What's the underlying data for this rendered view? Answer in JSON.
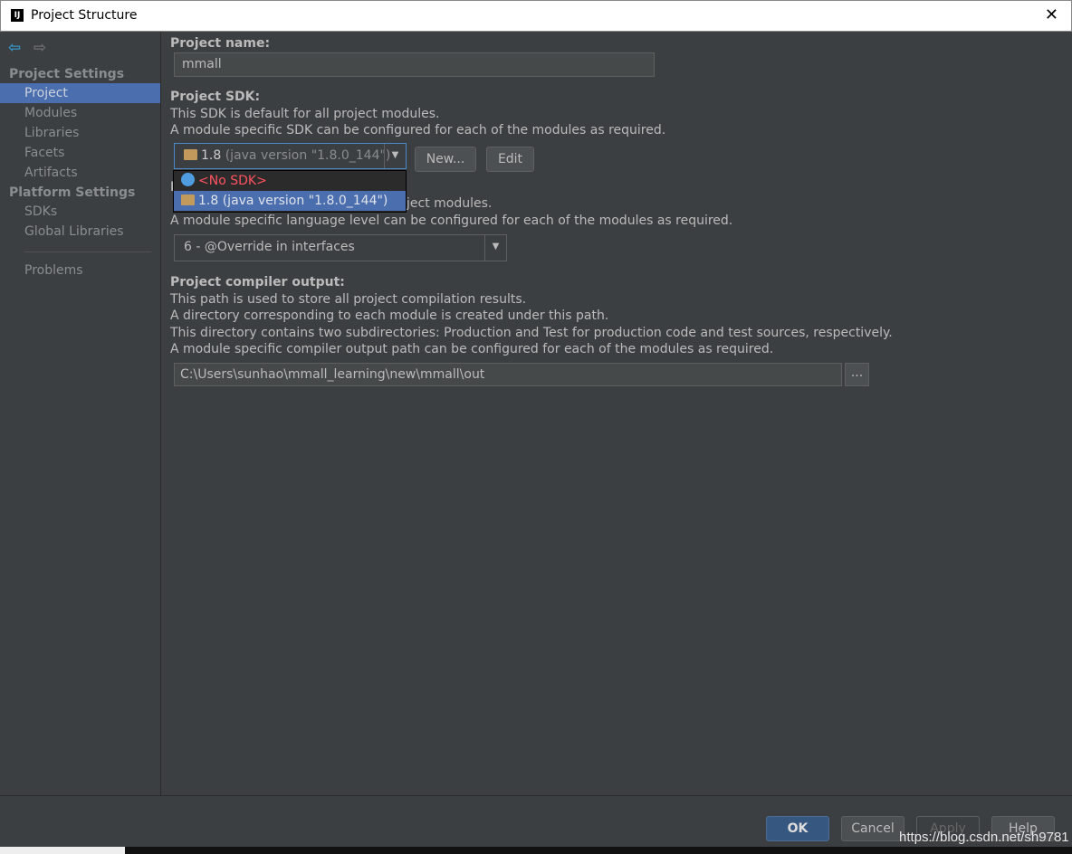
{
  "window": {
    "title": "Project Structure",
    "close_icon": "close-icon"
  },
  "sidebar": {
    "back_icon": "arrow-left-icon",
    "forward_icon": "arrow-right-icon",
    "section1": "Project Settings",
    "items1": [
      {
        "label": "Project",
        "selected": true
      },
      {
        "label": "Modules"
      },
      {
        "label": "Libraries"
      },
      {
        "label": "Facets"
      },
      {
        "label": "Artifacts"
      }
    ],
    "section2": "Platform Settings",
    "items2": [
      {
        "label": "SDKs"
      },
      {
        "label": "Global Libraries"
      }
    ],
    "problems": "Problems"
  },
  "main": {
    "name_label": "Project name:",
    "name_value": "mmall",
    "sdk_label": "Project SDK:",
    "sdk_desc1": "This SDK is default for all project modules.",
    "sdk_desc2": "A module specific SDK can be configured for each of the modules as required.",
    "sdk_selected_version": "1.8",
    "sdk_selected_detail": "(java version \"1.8.0_144\")",
    "new_button": "New...",
    "edit_button": "Edit",
    "sdk_options": [
      "<No SDK>",
      "1.8 (java version \"1.8.0_144\")"
    ],
    "lang_desc1": "ject modules.",
    "lang_desc2": "A module specific language level can be configured for each of the modules as required.",
    "lang_value": "6 - @Override in interfaces",
    "out_label": "Project compiler output:",
    "out_desc": [
      "This path is used to store all project compilation results.",
      "A directory corresponding to each module is created under this path.",
      "This directory contains two subdirectories: Production and Test for production code and test sources, respectively.",
      "A module specific compiler output path can be configured for each of the modules as required."
    ],
    "out_path": "C:\\Users\\sunhao\\mmall_learning\\new\\mmall\\out",
    "browse_button": "..."
  },
  "footer": {
    "ok": "OK",
    "cancel": "Cancel",
    "apply": "Apply",
    "help": "Help"
  },
  "watermark": "https://blog.csdn.net/sh9781",
  "colors": {
    "accent": "#4b6eaf",
    "background": "#3c3f41",
    "no_sdk": "#ff5261"
  }
}
